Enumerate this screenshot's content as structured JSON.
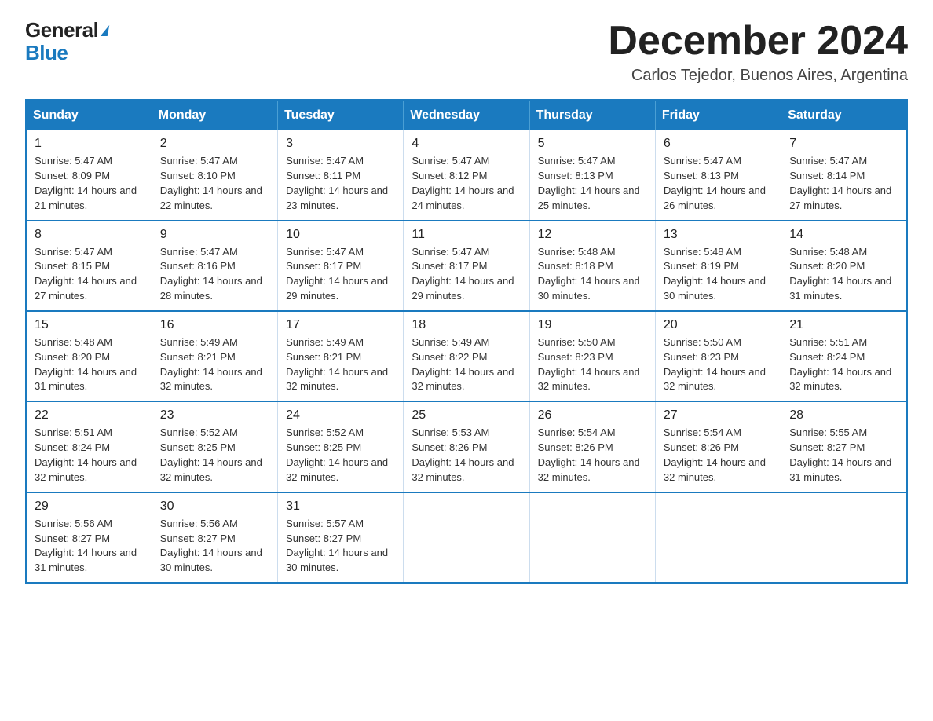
{
  "logo": {
    "general": "General",
    "blue": "Blue"
  },
  "title": "December 2024",
  "location": "Carlos Tejedor, Buenos Aires, Argentina",
  "weekdays": [
    "Sunday",
    "Monday",
    "Tuesday",
    "Wednesday",
    "Thursday",
    "Friday",
    "Saturday"
  ],
  "weeks": [
    [
      {
        "day": "1",
        "sunrise": "5:47 AM",
        "sunset": "8:09 PM",
        "daylight": "14 hours and 21 minutes."
      },
      {
        "day": "2",
        "sunrise": "5:47 AM",
        "sunset": "8:10 PM",
        "daylight": "14 hours and 22 minutes."
      },
      {
        "day": "3",
        "sunrise": "5:47 AM",
        "sunset": "8:11 PM",
        "daylight": "14 hours and 23 minutes."
      },
      {
        "day": "4",
        "sunrise": "5:47 AM",
        "sunset": "8:12 PM",
        "daylight": "14 hours and 24 minutes."
      },
      {
        "day": "5",
        "sunrise": "5:47 AM",
        "sunset": "8:13 PM",
        "daylight": "14 hours and 25 minutes."
      },
      {
        "day": "6",
        "sunrise": "5:47 AM",
        "sunset": "8:13 PM",
        "daylight": "14 hours and 26 minutes."
      },
      {
        "day": "7",
        "sunrise": "5:47 AM",
        "sunset": "8:14 PM",
        "daylight": "14 hours and 27 minutes."
      }
    ],
    [
      {
        "day": "8",
        "sunrise": "5:47 AM",
        "sunset": "8:15 PM",
        "daylight": "14 hours and 27 minutes."
      },
      {
        "day": "9",
        "sunrise": "5:47 AM",
        "sunset": "8:16 PM",
        "daylight": "14 hours and 28 minutes."
      },
      {
        "day": "10",
        "sunrise": "5:47 AM",
        "sunset": "8:17 PM",
        "daylight": "14 hours and 29 minutes."
      },
      {
        "day": "11",
        "sunrise": "5:47 AM",
        "sunset": "8:17 PM",
        "daylight": "14 hours and 29 minutes."
      },
      {
        "day": "12",
        "sunrise": "5:48 AM",
        "sunset": "8:18 PM",
        "daylight": "14 hours and 30 minutes."
      },
      {
        "day": "13",
        "sunrise": "5:48 AM",
        "sunset": "8:19 PM",
        "daylight": "14 hours and 30 minutes."
      },
      {
        "day": "14",
        "sunrise": "5:48 AM",
        "sunset": "8:20 PM",
        "daylight": "14 hours and 31 minutes."
      }
    ],
    [
      {
        "day": "15",
        "sunrise": "5:48 AM",
        "sunset": "8:20 PM",
        "daylight": "14 hours and 31 minutes."
      },
      {
        "day": "16",
        "sunrise": "5:49 AM",
        "sunset": "8:21 PM",
        "daylight": "14 hours and 32 minutes."
      },
      {
        "day": "17",
        "sunrise": "5:49 AM",
        "sunset": "8:21 PM",
        "daylight": "14 hours and 32 minutes."
      },
      {
        "day": "18",
        "sunrise": "5:49 AM",
        "sunset": "8:22 PM",
        "daylight": "14 hours and 32 minutes."
      },
      {
        "day": "19",
        "sunrise": "5:50 AM",
        "sunset": "8:23 PM",
        "daylight": "14 hours and 32 minutes."
      },
      {
        "day": "20",
        "sunrise": "5:50 AM",
        "sunset": "8:23 PM",
        "daylight": "14 hours and 32 minutes."
      },
      {
        "day": "21",
        "sunrise": "5:51 AM",
        "sunset": "8:24 PM",
        "daylight": "14 hours and 32 minutes."
      }
    ],
    [
      {
        "day": "22",
        "sunrise": "5:51 AM",
        "sunset": "8:24 PM",
        "daylight": "14 hours and 32 minutes."
      },
      {
        "day": "23",
        "sunrise": "5:52 AM",
        "sunset": "8:25 PM",
        "daylight": "14 hours and 32 minutes."
      },
      {
        "day": "24",
        "sunrise": "5:52 AM",
        "sunset": "8:25 PM",
        "daylight": "14 hours and 32 minutes."
      },
      {
        "day": "25",
        "sunrise": "5:53 AM",
        "sunset": "8:26 PM",
        "daylight": "14 hours and 32 minutes."
      },
      {
        "day": "26",
        "sunrise": "5:54 AM",
        "sunset": "8:26 PM",
        "daylight": "14 hours and 32 minutes."
      },
      {
        "day": "27",
        "sunrise": "5:54 AM",
        "sunset": "8:26 PM",
        "daylight": "14 hours and 32 minutes."
      },
      {
        "day": "28",
        "sunrise": "5:55 AM",
        "sunset": "8:27 PM",
        "daylight": "14 hours and 31 minutes."
      }
    ],
    [
      {
        "day": "29",
        "sunrise": "5:56 AM",
        "sunset": "8:27 PM",
        "daylight": "14 hours and 31 minutes."
      },
      {
        "day": "30",
        "sunrise": "5:56 AM",
        "sunset": "8:27 PM",
        "daylight": "14 hours and 30 minutes."
      },
      {
        "day": "31",
        "sunrise": "5:57 AM",
        "sunset": "8:27 PM",
        "daylight": "14 hours and 30 minutes."
      },
      null,
      null,
      null,
      null
    ]
  ]
}
